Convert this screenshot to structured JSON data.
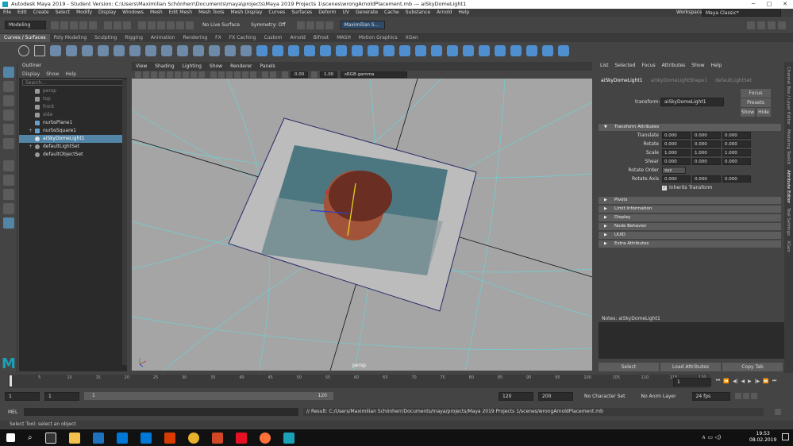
{
  "window": {
    "title": "Autodesk Maya 2019 - Student Version: C:\\Users\\Maximilian Schönherr\\Documents\\maya\\projects\\Maya 2019 Projects 1\\scenes\\wrongArnoldPlacement.mb   ---   aiSkyDomeLight1"
  },
  "menubar": [
    "File",
    "Edit",
    "Create",
    "Select",
    "Modify",
    "Display",
    "Windows",
    "Mesh",
    "Edit Mesh",
    "Mesh Tools",
    "Mesh Display",
    "Curves",
    "Surfaces",
    "Deform",
    "UV",
    "Generate",
    "Cache",
    "Substance",
    "Arnold",
    "Help"
  ],
  "workspace": {
    "label": "Workspace :",
    "value": "Maya Classic*"
  },
  "statusline": {
    "mode": "Modeling",
    "live_surface": "No Live Surface",
    "symmetry": "Symmetry: Off",
    "user": "Maximilian S..."
  },
  "shelf_tabs": [
    "Curves / Surfaces",
    "Poly Modeling",
    "Sculpting",
    "Rigging",
    "Animation",
    "Rendering",
    "FX",
    "FX Caching",
    "Custom",
    "Arnold",
    "Bifrost",
    "MASH",
    "Motion Graphics",
    "XGen"
  ],
  "outliner": {
    "title": "Outliner",
    "menu": [
      "Display",
      "Show",
      "Help"
    ],
    "search_placeholder": "Search...",
    "items": [
      {
        "label": "persp",
        "dim": true
      },
      {
        "label": "top",
        "dim": true
      },
      {
        "label": "front",
        "dim": true
      },
      {
        "label": "side",
        "dim": true
      },
      {
        "label": "nurbsPlane1",
        "dim": false
      },
      {
        "label": "nurbsSquare1",
        "dim": false
      },
      {
        "label": "aiSkyDomeLight1",
        "dim": false,
        "selected": true
      },
      {
        "label": "defaultLightSet",
        "dim": false
      },
      {
        "label": "defaultObjectSet",
        "dim": false
      }
    ]
  },
  "viewport": {
    "menu": [
      "View",
      "Shading",
      "Lighting",
      "Show",
      "Renderer",
      "Panels"
    ],
    "value1": "0.00",
    "value2": "1.00",
    "colorspace": "sRGB gamma",
    "camera_label": "persp"
  },
  "attribute_editor": {
    "menu": [
      "List",
      "Selected",
      "Focus",
      "Attributes",
      "Show",
      "Help"
    ],
    "tabs": [
      "aiSkyDomeLight1",
      "aiSkyDomeLightShape1",
      "defaultLightSet"
    ],
    "transform_label": "transform:",
    "transform_value": "aiSkyDomeLight1",
    "focus": "Focus",
    "presets": "Presets",
    "show": "Show",
    "hide": "Hide",
    "transform_section": "Transform Attributes",
    "translate": {
      "label": "Translate",
      "v": [
        "0.000",
        "0.000",
        "0.000"
      ]
    },
    "rotate": {
      "label": "Rotate",
      "v": [
        "0.000",
        "0.000",
        "0.000"
      ]
    },
    "scale": {
      "label": "Scale",
      "v": [
        "1.000",
        "1.000",
        "1.000"
      ]
    },
    "shear": {
      "label": "Shear",
      "v": [
        "0.000",
        "0.000",
        "0.000"
      ]
    },
    "rotate_order": {
      "label": "Rotate Order",
      "v": "xyz"
    },
    "rotate_axis": {
      "label": "Rotate Axis",
      "v": [
        "0.000",
        "0.000",
        "0.000"
      ]
    },
    "inherits": "Inherits Transform",
    "sections": [
      "Pivots",
      "Limit Information",
      "Display",
      "Node Behavior",
      "UUID",
      "Extra Attributes"
    ],
    "notes": "Notes:  aiSkyDomeLight1",
    "buttons": [
      "Select",
      "Load Attributes",
      "Copy Tab"
    ]
  },
  "right_strip": [
    "Channel Box / Layer Editor",
    "Modeling Toolkit",
    "Attribute Editor",
    "Tool Settings",
    "XGen"
  ],
  "timeline": {
    "ticks": [
      "1",
      "5",
      "10",
      "15",
      "20",
      "25",
      "30",
      "35",
      "40",
      "45",
      "50",
      "55",
      "60",
      "65",
      "70",
      "75",
      "80",
      "85",
      "90",
      "95",
      "100",
      "105",
      "110",
      "115",
      "120"
    ],
    "current": "1"
  },
  "range": {
    "start": "1",
    "start2": "1",
    "slider_start": "1",
    "slider_end": "120",
    "end": "120",
    "end2": "200",
    "character": "No Character Set",
    "anim_layer": "No Anim Layer",
    "fps": "24 fps"
  },
  "command": {
    "label": "MEL",
    "result": "// Result: C:/Users/Maximilian Schönherr/Documents/maya/projects/Maya 2019 Projects 1/scenes/wrongArnoldPlacement.mb"
  },
  "helpline": "Select Tool: select an object",
  "taskbar": {
    "time": "19:53",
    "date": "08.02.2019"
  }
}
